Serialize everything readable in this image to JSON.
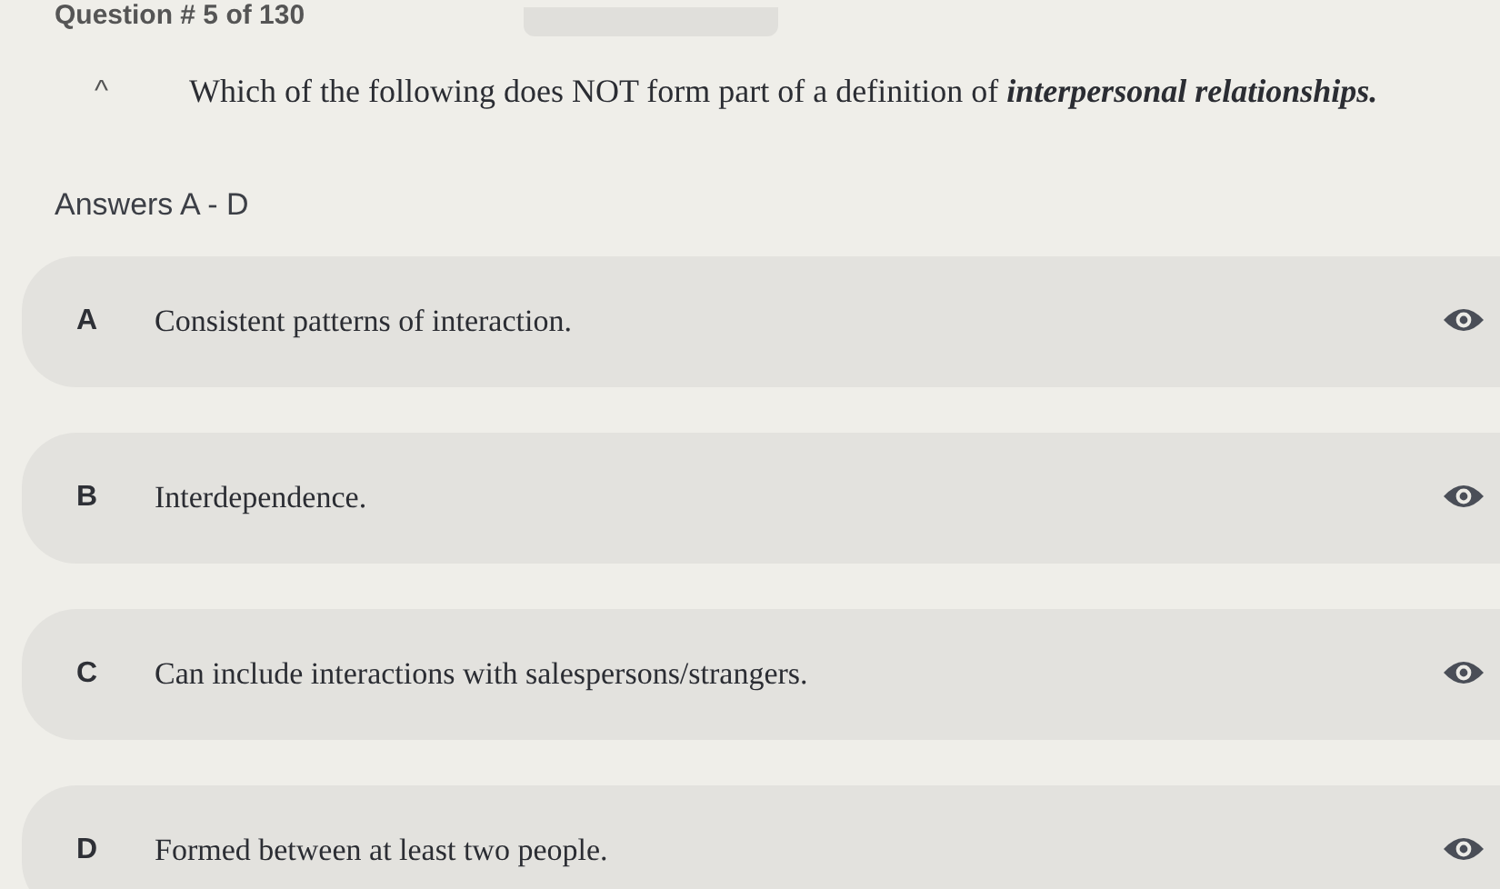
{
  "header": {
    "question_counter": "Question # 5 of 130"
  },
  "question": {
    "collapse_icon": "^",
    "text": "Which of the following does NOT form part of a definition of *interpersonal relationships.*"
  },
  "answers_heading": "Answers A - D",
  "answers": [
    {
      "letter": "A",
      "text": "Consistent patterns of interaction."
    },
    {
      "letter": "B",
      "text": "Interdependence."
    },
    {
      "letter": "C",
      "text": "Can include interactions with salespersons/strangers."
    },
    {
      "letter": "D",
      "text": "Formed between at least two people."
    }
  ]
}
